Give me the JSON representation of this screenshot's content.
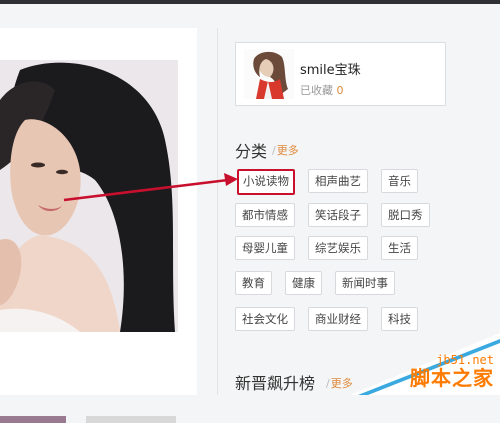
{
  "user": {
    "name": "smile宝珠",
    "favorites_label": "已收藏",
    "favorites_count": "0"
  },
  "categories": {
    "title": "分类",
    "more": "更多",
    "tags": [
      "小说读物",
      "相声曲艺",
      "音乐",
      "都市情感",
      "笑话段子",
      "脱口秀",
      "母婴儿童",
      "综艺娱乐",
      "生活",
      "教育",
      "健康",
      "新闻时事",
      "社会文化",
      "商业财经",
      "科技"
    ],
    "highlighted_tag": "小说读物"
  },
  "ranking": {
    "title": "新晋飙升榜",
    "more": "更多"
  },
  "watermark": {
    "site": "jb51.net",
    "name": "脚本之家"
  },
  "colors": {
    "accent": "#e08a3c",
    "highlight": "#c8102e",
    "watermark": "#ff7b00"
  },
  "icons": [
    "avatar-illustration",
    "annotation-arrow"
  ]
}
